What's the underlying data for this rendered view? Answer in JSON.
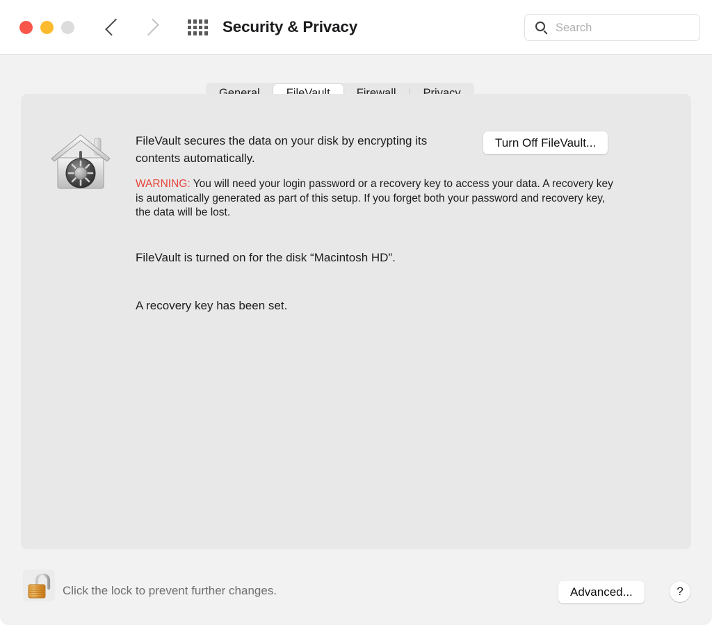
{
  "window": {
    "title": "Security & Privacy",
    "traffic_lights": {
      "close_color": "#f8564b",
      "minimize_color": "#fcbb2e",
      "zoom_color": "#dcdcdc"
    }
  },
  "toolbar": {
    "back_icon": "chevron-left-icon",
    "forward_icon": "chevron-right-icon",
    "grid_icon": "show-all-grid-icon"
  },
  "search": {
    "placeholder": "Search",
    "value": "",
    "icon": "search-icon"
  },
  "tabs": [
    {
      "label": "General",
      "selected": false
    },
    {
      "label": "FileVault",
      "selected": true
    },
    {
      "label": "Firewall",
      "selected": false
    },
    {
      "label": "Privacy",
      "selected": false
    }
  ],
  "main": {
    "icon": "filevault-house-safe-icon",
    "description": "FileVault secures the data on your disk by encrypting its contents automatically.",
    "warning_label": "WARNING:",
    "warning_text": " You will need your login password or a recovery key to access your data. A recovery key is automatically generated as part of this setup. If you forget both your password and recovery key, the data will be lost.",
    "warning_color": "#e8453c",
    "status_line_1": "FileVault is turned on for the disk “Macintosh HD”.",
    "status_line_2": "A recovery key has been set.",
    "turn_off_button": "Turn Off FileVault..."
  },
  "footer": {
    "lock_icon": "unlocked-padlock-icon",
    "lock_caption": "Click the lock to prevent further changes.",
    "advanced_button": "Advanced...",
    "help_button": "?"
  }
}
